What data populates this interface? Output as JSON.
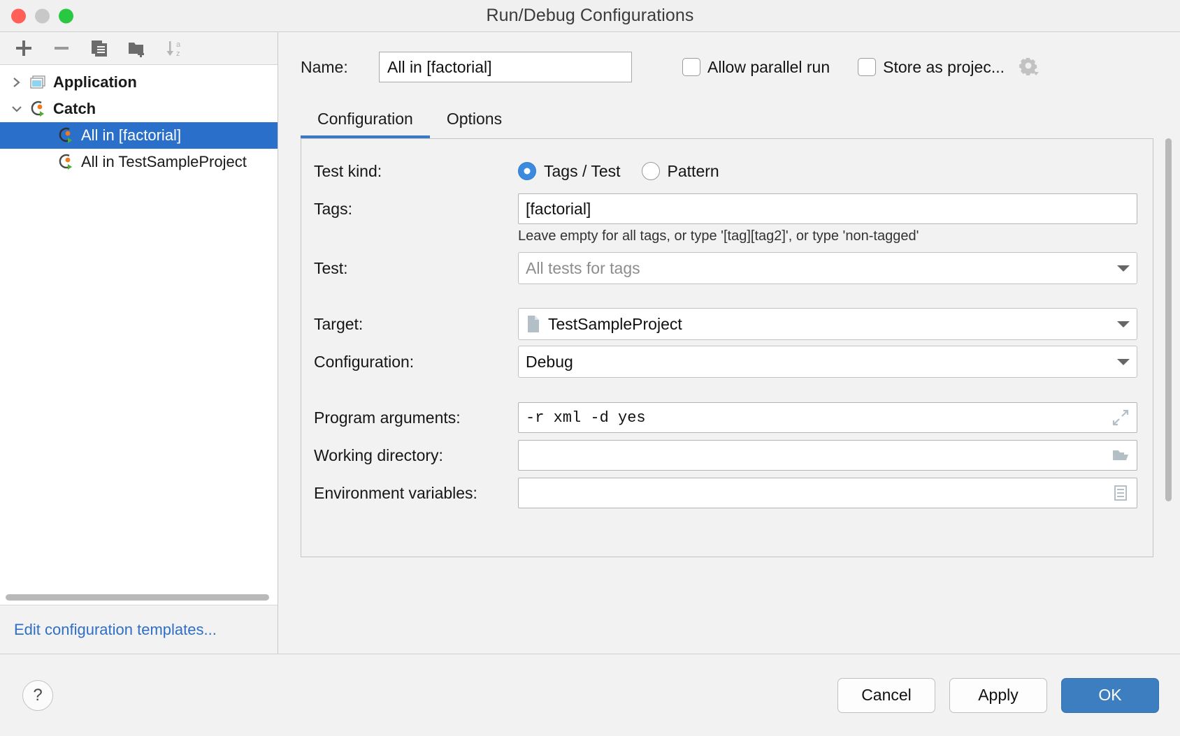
{
  "window": {
    "title": "Run/Debug Configurations",
    "traffic_lights": [
      "close-button",
      "minimize-button",
      "zoom-button"
    ]
  },
  "sidebar": {
    "toolbar": [
      {
        "name": "add-configuration-button",
        "icon": "plus-icon"
      },
      {
        "name": "remove-configuration-button",
        "icon": "minus-icon"
      },
      {
        "name": "copy-configuration-button",
        "icon": "copy-icon"
      },
      {
        "name": "new-folder-button",
        "icon": "new-folder-icon"
      },
      {
        "name": "sort-configurations-button",
        "icon": "sort-alphabetical-icon"
      }
    ],
    "tree": [
      {
        "label": "Application",
        "type": "group",
        "expanded": false,
        "icon": "application-icon"
      },
      {
        "label": "Catch",
        "type": "group",
        "expanded": true,
        "icon": "catch-icon"
      },
      {
        "label": "All in [factorial]",
        "type": "child",
        "selected": true,
        "icon": "catch-icon"
      },
      {
        "label": "All in TestSampleProject",
        "type": "child",
        "selected": false,
        "icon": "catch-icon"
      }
    ],
    "edit_templates_link": "Edit configuration templates..."
  },
  "header": {
    "name_label": "Name:",
    "name_value": "All in [factorial]",
    "allow_parallel_run_label": "Allow parallel run",
    "allow_parallel_run_checked": false,
    "store_as_project_label": "Store as projec...",
    "store_as_project_checked": false,
    "settings_gear": "gear-dropdown-icon"
  },
  "tabs": [
    {
      "label": "Configuration",
      "active": true
    },
    {
      "label": "Options",
      "active": false
    }
  ],
  "form": {
    "test_kind": {
      "label": "Test kind:",
      "options": [
        {
          "label": "Tags / Test",
          "selected": true
        },
        {
          "label": "Pattern",
          "selected": false
        }
      ]
    },
    "tags": {
      "label": "Tags:",
      "value": "[factorial]",
      "hint": "Leave empty for all tags, or type '[tag][tag2]', or type 'non-tagged'"
    },
    "test": {
      "label": "Test:",
      "value": "",
      "placeholder": "All tests for tags"
    },
    "target": {
      "label": "Target:",
      "value": "TestSampleProject",
      "icon": "target-file-icon"
    },
    "configuration": {
      "label": "Configuration:",
      "value": "Debug"
    },
    "program_arguments": {
      "label": "Program arguments:",
      "value": "-r xml -d yes",
      "button_icon": "expand-icon"
    },
    "working_directory": {
      "label": "Working directory:",
      "value": "",
      "button_icon": "folder-icon"
    },
    "environment_variables": {
      "label": "Environment variables:",
      "value": "",
      "button_icon": "list-icon"
    }
  },
  "footer": {
    "help_label": "?",
    "cancel_label": "Cancel",
    "apply_label": "Apply",
    "ok_label": "OK"
  },
  "colors": {
    "accent_blue": "#2a6fc9",
    "tab_underline": "#3c78c8",
    "primary_button": "#3c7ebf",
    "link": "#2f6fc6"
  }
}
